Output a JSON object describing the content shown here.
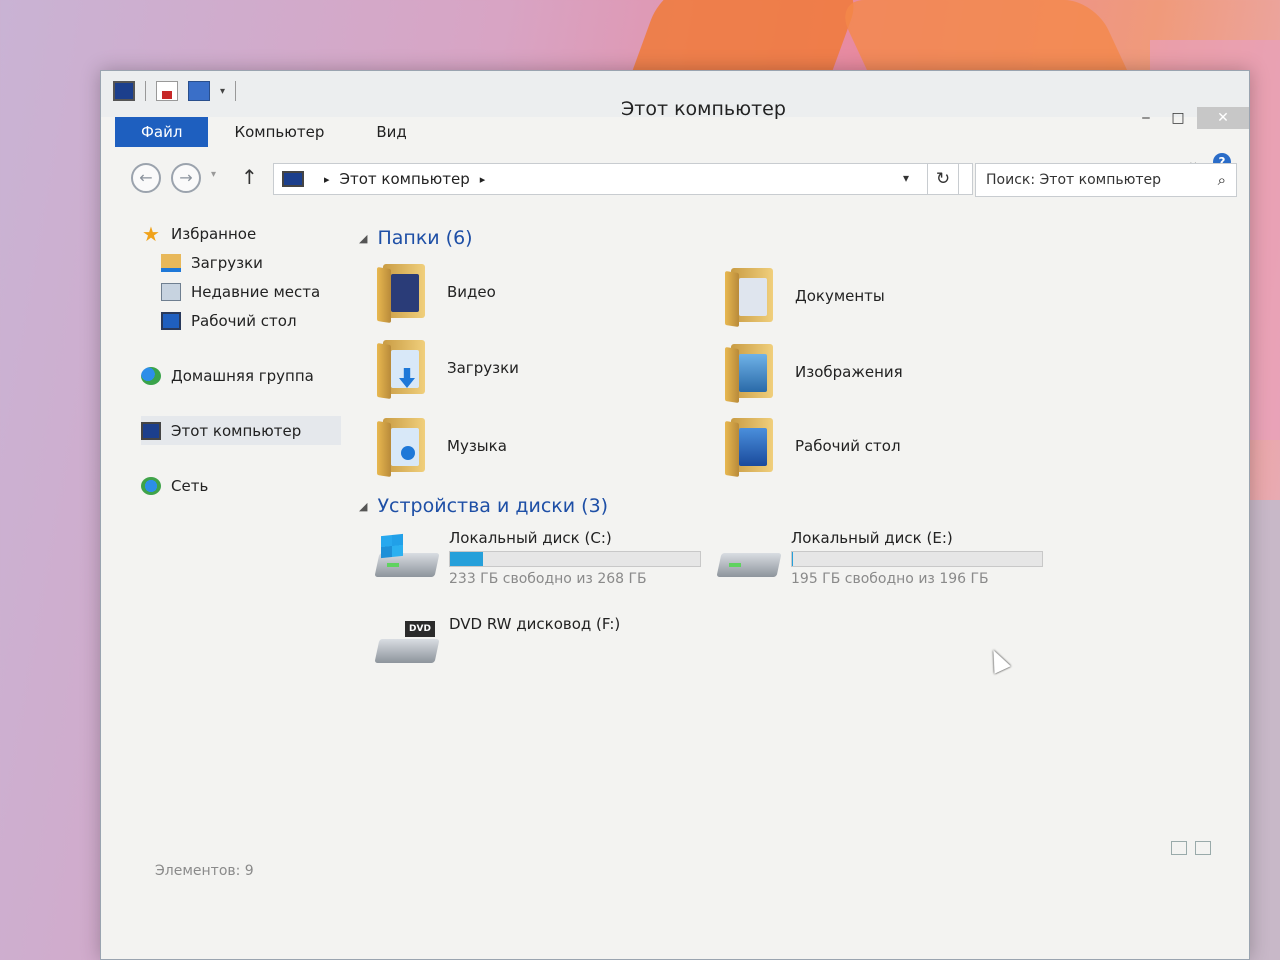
{
  "window": {
    "title": "Этот компьютер",
    "controls": {
      "minimize": "‒",
      "maximize": "□",
      "close": "✕"
    }
  },
  "ribbon": {
    "tabs": [
      {
        "label": "Файл"
      },
      {
        "label": "Компьютер"
      },
      {
        "label": "Вид"
      }
    ],
    "help": "?",
    "collapse": "⌄"
  },
  "navigation": {
    "back": "←",
    "forward": "→",
    "history": "▾",
    "up": "↑",
    "address": [
      "Этот компьютер"
    ],
    "address_sep": "▸",
    "dropdown": "▾",
    "refresh": "↻",
    "search_placeholder": "Поиск: Этот компьютер",
    "search_icon": "⌕"
  },
  "sidebar": {
    "favorites": {
      "label": "Избранное",
      "icon": "star-icon"
    },
    "favorites_items": [
      {
        "label": "Загрузки",
        "icon": "downloads-folder-icon"
      },
      {
        "label": "Недавние места",
        "icon": "recent-places-icon"
      },
      {
        "label": "Рабочий стол",
        "icon": "desktop-icon"
      }
    ],
    "homegroup": {
      "label": "Домашняя группа",
      "icon": "homegroup-icon"
    },
    "this_pc": {
      "label": "Этот компьютер",
      "icon": "computer-icon"
    },
    "network": {
      "label": "Сеть",
      "icon": "network-icon"
    }
  },
  "content": {
    "folders_header": "Папки (6)",
    "folders": [
      {
        "label": "Видео",
        "icon": "video-folder-icon"
      },
      {
        "label": "Документы",
        "icon": "documents-folder-icon"
      },
      {
        "label": "Загрузки",
        "icon": "downloads-folder-icon"
      },
      {
        "label": "Изображения",
        "icon": "pictures-folder-icon"
      },
      {
        "label": "Музыка",
        "icon": "music-folder-icon"
      },
      {
        "label": "Рабочий стол",
        "icon": "desktop-folder-icon"
      }
    ],
    "drives_header": "Устройства и диски (3)",
    "drives": [
      {
        "name": "Локальный диск (C:)",
        "free_text": "233 ГБ свободно из 268 ГБ",
        "used_fraction": 0.13,
        "icon": "windows-drive-icon"
      },
      {
        "name": "Локальный диск (E:)",
        "free_text": "195 ГБ свободно из 196 ГБ",
        "used_fraction": 0.005,
        "icon": "hard-drive-icon"
      },
      {
        "name": "DVD RW дисковод (F:)",
        "icon": "dvd-drive-icon",
        "badge": "DVD"
      }
    ]
  },
  "status": {
    "items_count": "Элементов: 9"
  },
  "colors": {
    "accent": "#1e5fbf",
    "drive_bar": "#26a0da",
    "group_header": "#1e4fa6"
  }
}
